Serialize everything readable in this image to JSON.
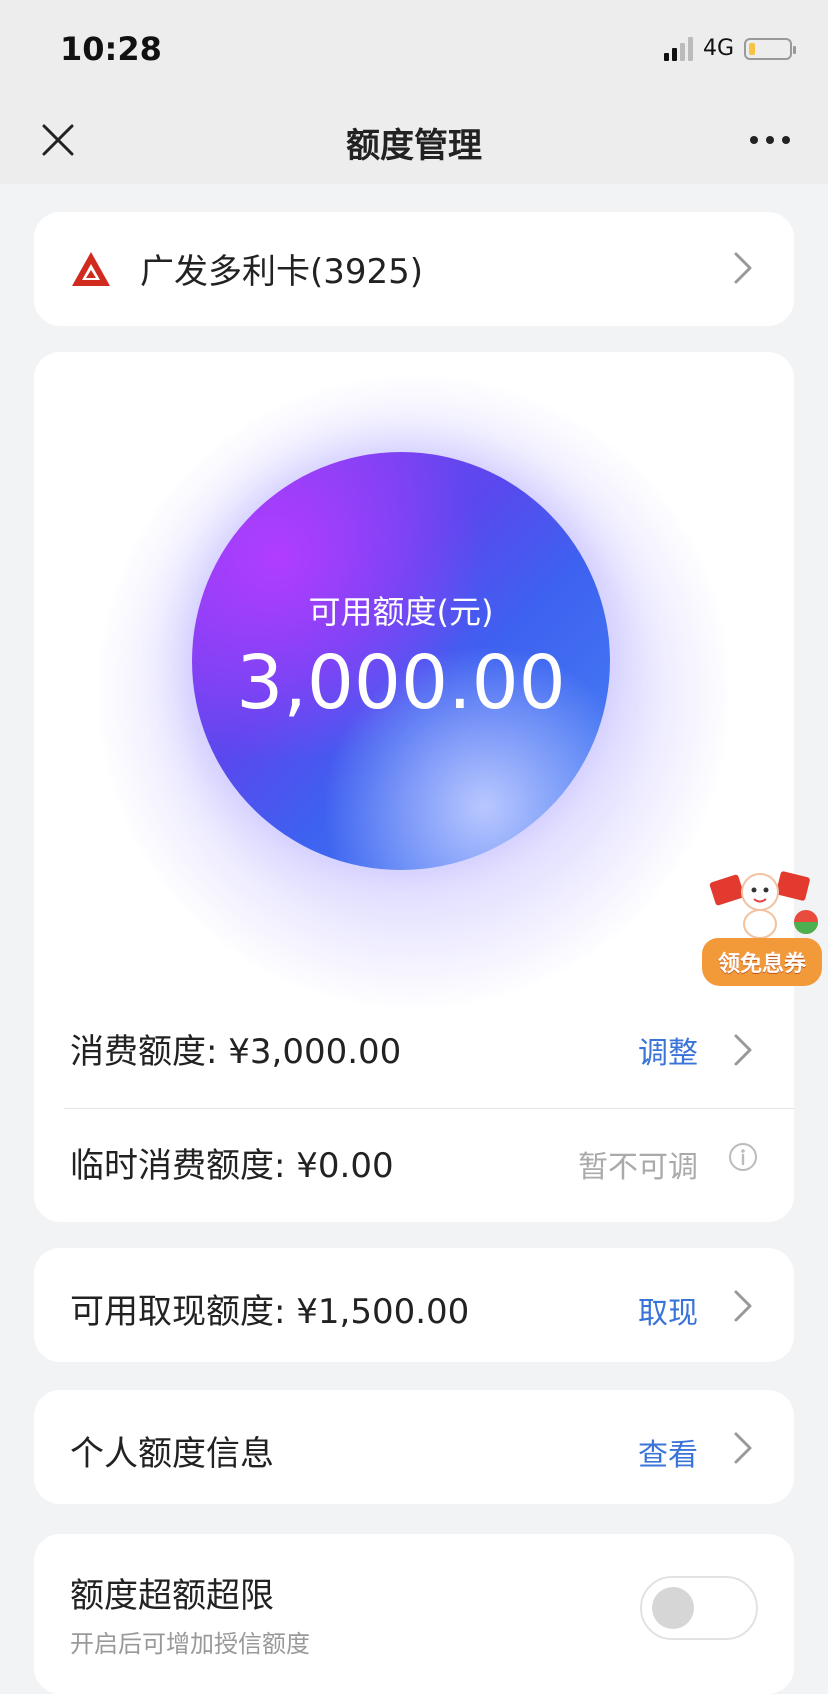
{
  "status_bar": {
    "time": "10:28",
    "network": "4G",
    "battery_level": 0.15
  },
  "nav": {
    "title": "额度管理",
    "close_icon": "close-icon",
    "more_icon": "more-icon"
  },
  "card_select": {
    "name": "广发多利卡(3925)",
    "logo": "cgb-bank-logo"
  },
  "credit": {
    "available_label": "可用额度(元)",
    "available_amount": "3,000.00",
    "consumption_label": "消费额度: ¥3,000.00",
    "consumption_action": "调整",
    "temporary_label": "临时消费额度: ¥0.00",
    "temporary_action": "暂不可调"
  },
  "promo": {
    "text": "领免息券"
  },
  "cash": {
    "label": "可用取现额度: ¥1,500.00",
    "action": "取现"
  },
  "personal": {
    "label": "个人额度信息",
    "action": "查看"
  },
  "overlimit": {
    "title": "额度超额超限",
    "subtitle": "开启后可增加授信额度",
    "enabled": false
  },
  "colors": {
    "accent": "#3b74d8",
    "background": "#f2f3f5",
    "orb_purple": "#8e3cf2",
    "orb_blue": "#4a86f5"
  }
}
